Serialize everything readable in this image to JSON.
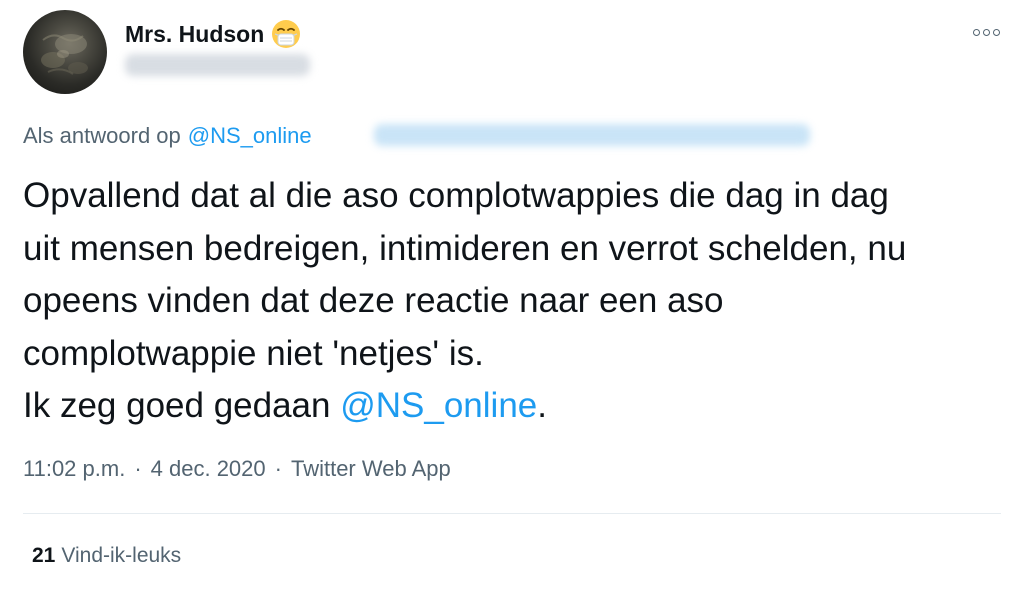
{
  "author": {
    "display_name": "Mrs. Hudson",
    "name_emoji": "face-with-medical-mask-icon",
    "avatar": "avatar-dark-sphere"
  },
  "menu": {
    "icon": "more-options-icon"
  },
  "reply_context": {
    "prefix": "Als antwoord op",
    "mention": "@NS_online"
  },
  "tweet": {
    "lines": [
      "Opvallend dat al die aso complotwappies die dag in dag",
      "uit mensen bedreigen, intimideren en verrot schelden, nu",
      "opeens vinden dat deze reactie naar een aso",
      "complotwappie niet 'netjes' is."
    ],
    "last_line_prefix": "Ik zeg goed gedaan ",
    "last_line_mention": "@NS_online",
    "last_line_suffix": "."
  },
  "meta": {
    "time": "11:02 p.m.",
    "separator": "·",
    "date": "4 dec. 2020",
    "source": "Twitter Web App"
  },
  "stats": {
    "likes_count": "21",
    "likes_label": "Vind-ik-leuks"
  },
  "colors": {
    "link": "#1d9bf0",
    "secondary_text": "#536471",
    "primary_text": "#0f1419",
    "divider": "#e6ecf0"
  }
}
